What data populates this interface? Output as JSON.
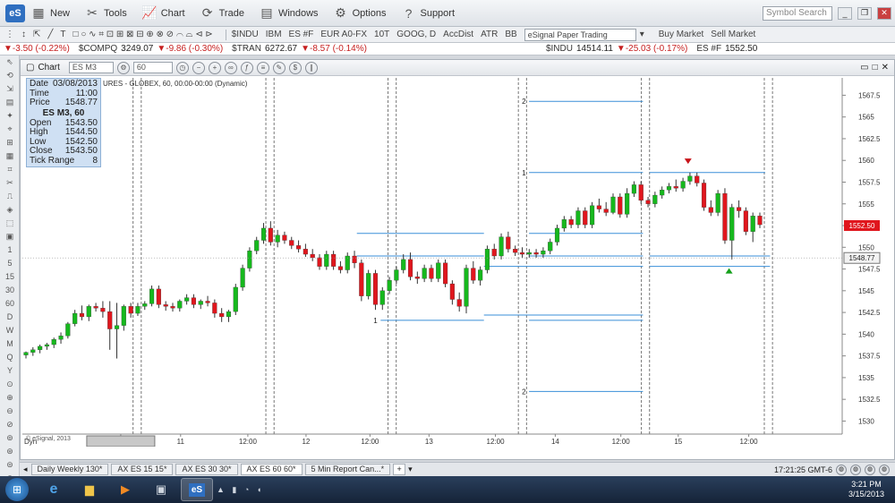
{
  "menu": {
    "logo": "eS",
    "items": [
      {
        "label": "New",
        "icon": "new-icon",
        "glyph": "▦"
      },
      {
        "label": "Tools",
        "icon": "tools-icon",
        "glyph": "✂"
      },
      {
        "label": "Chart",
        "icon": "chart-icon",
        "glyph": "📈"
      },
      {
        "label": "Trade",
        "icon": "trade-icon",
        "glyph": "⟳"
      },
      {
        "label": "Windows",
        "icon": "windows-icon",
        "glyph": "▤"
      },
      {
        "label": "Options",
        "icon": "options-gear-icon",
        "glyph": "⚙"
      },
      {
        "label": "Support",
        "icon": "support-help-icon",
        "glyph": "?"
      }
    ],
    "symbol_search_placeholder": "Symbol Search"
  },
  "toolbar": {
    "quick_symbols": [
      "$INDU",
      "IBM",
      "ES #F",
      "EUR A0-FX",
      "10T",
      "GOOG, D",
      "AccDist",
      "ATR",
      "BB"
    ],
    "account": "eSignal Paper Trading",
    "buy_market": "Buy Market",
    "sell_market": "Sell Market"
  },
  "ticker": [
    {
      "symbol": "",
      "change": "-3.50 (-0.22%)"
    },
    {
      "symbol": "$COMPQ",
      "price": "3249.07",
      "change": "-9.86 (-0.30%)"
    },
    {
      "symbol": "$TRAN",
      "price": "6272.67",
      "change": "-8.57 (-0.14%)"
    },
    {
      "symbol": "$INDU",
      "price": "14514.11",
      "change": "-25.03 (-0.17%)"
    },
    {
      "symbol": "ES #F",
      "price": "1552.50",
      "change": ""
    }
  ],
  "lefttools": [
    "1",
    "5",
    "15",
    "30",
    "60",
    "D",
    "W",
    "M",
    "Q",
    "Y"
  ],
  "chart_window": {
    "tab_label": "Chart",
    "symbol": "ES M3",
    "interval": "60",
    "title": "URES - GLOBEX, 60, 00:00-00:00 (Dynamic)",
    "copyright": "© eSignal, 2013",
    "dyn_label": "Dyn"
  },
  "info_panel": {
    "date_label": "Date",
    "date": "03/08/2013",
    "time_label": "Time",
    "time": "11:00",
    "price_label": "Price",
    "price": "1548.77",
    "symbol": "ES M3, 60",
    "open_label": "Open",
    "open": "1543.50",
    "high_label": "High",
    "high": "1544.50",
    "low_label": "Low",
    "low": "1542.50",
    "close_label": "Close",
    "close": "1543.50",
    "tick_label": "Tick Range",
    "tick": "8"
  },
  "chart_data": {
    "type": "candlestick",
    "ylim": [
      1528.5,
      1569.5
    ],
    "y_ticks": [
      1530,
      1532.5,
      1535,
      1537.5,
      1540,
      1542.5,
      1545,
      1547.5,
      1550,
      1552.5,
      1555,
      1557.5,
      1560,
      1562.5,
      1565,
      1567.5
    ],
    "x_labels": [
      "11:00 03/08/2013",
      "11",
      "12:00",
      "12",
      "12:00",
      "13",
      "12:00",
      "14",
      "12:00",
      "15",
      "12:00"
    ],
    "current_price": "1552.50",
    "cursor_price": "1548.77",
    "candles": [
      [
        1537.6,
        1538.0,
        1537.2,
        1537.9
      ],
      [
        1537.9,
        1538.5,
        1537.5,
        1538.2
      ],
      [
        1538.2,
        1538.8,
        1537.8,
        1538.6
      ],
      [
        1538.6,
        1539.0,
        1538.2,
        1538.8
      ],
      [
        1538.8,
        1539.6,
        1538.4,
        1539.4
      ],
      [
        1539.4,
        1540.2,
        1538.9,
        1539.8
      ],
      [
        1539.8,
        1541.4,
        1539.5,
        1541.2
      ],
      [
        1541.2,
        1542.8,
        1540.9,
        1542.4
      ],
      [
        1542.4,
        1543.3,
        1541.6,
        1542.0
      ],
      [
        1542.0,
        1543.4,
        1541.5,
        1543.2
      ],
      [
        1543.2,
        1543.6,
        1542.6,
        1543.0
      ],
      [
        1543.0,
        1543.8,
        1541.9,
        1542.6
      ],
      [
        1542.6,
        1543.8,
        1538.2,
        1540.6
      ],
      [
        1540.6,
        1543.6,
        1537.2,
        1541.0
      ],
      [
        1541.0,
        1543.4,
        1540.4,
        1543.2
      ],
      [
        1543.2,
        1543.6,
        1541.9,
        1542.4
      ],
      [
        1542.4,
        1543.6,
        1542.1,
        1543.2
      ],
      [
        1543.2,
        1543.8,
        1542.8,
        1543.5
      ],
      [
        1543.5,
        1545.6,
        1543.2,
        1545.2
      ],
      [
        1545.2,
        1545.6,
        1543.0,
        1543.4
      ],
      [
        1543.4,
        1543.8,
        1542.7,
        1543.2
      ],
      [
        1543.2,
        1543.6,
        1542.6,
        1543.0
      ],
      [
        1543.0,
        1544.0,
        1542.6,
        1543.8
      ],
      [
        1543.8,
        1544.6,
        1543.4,
        1544.2
      ],
      [
        1544.2,
        1544.6,
        1543.0,
        1543.4
      ],
      [
        1543.4,
        1544.0,
        1542.9,
        1543.8
      ],
      [
        1543.8,
        1544.4,
        1543.2,
        1543.6
      ],
      [
        1543.6,
        1544.0,
        1541.9,
        1542.4
      ],
      [
        1542.4,
        1543.0,
        1541.4,
        1542.0
      ],
      [
        1542.0,
        1542.8,
        1541.4,
        1542.6
      ],
      [
        1542.6,
        1545.8,
        1542.2,
        1545.4
      ],
      [
        1545.4,
        1548.0,
        1545.0,
        1547.6
      ],
      [
        1547.6,
        1550.0,
        1547.2,
        1549.6
      ],
      [
        1549.6,
        1551.2,
        1549.2,
        1550.8
      ],
      [
        1550.8,
        1552.8,
        1550.4,
        1552.2
      ],
      [
        1552.2,
        1553.0,
        1550.2,
        1550.6
      ],
      [
        1550.6,
        1552.0,
        1550.0,
        1551.4
      ],
      [
        1551.4,
        1551.8,
        1550.4,
        1550.8
      ],
      [
        1550.8,
        1551.2,
        1549.8,
        1550.2
      ],
      [
        1550.2,
        1550.8,
        1549.4,
        1549.8
      ],
      [
        1549.8,
        1550.4,
        1548.9,
        1549.2
      ],
      [
        1549.2,
        1549.8,
        1548.4,
        1548.8
      ],
      [
        1548.8,
        1549.2,
        1547.4,
        1547.8
      ],
      [
        1547.8,
        1549.6,
        1547.4,
        1549.2
      ],
      [
        1549.2,
        1549.6,
        1547.4,
        1547.8
      ],
      [
        1547.8,
        1548.4,
        1547.0,
        1547.4
      ],
      [
        1547.4,
        1549.4,
        1547.0,
        1549.0
      ],
      [
        1549.0,
        1549.6,
        1547.6,
        1548.2
      ],
      [
        1548.2,
        1548.6,
        1543.8,
        1544.4
      ],
      [
        1544.4,
        1547.4,
        1544.0,
        1547.0
      ],
      [
        1547.0,
        1547.4,
        1542.8,
        1543.4
      ],
      [
        1543.4,
        1545.4,
        1542.8,
        1545.0
      ],
      [
        1545.0,
        1546.6,
        1544.6,
        1546.2
      ],
      [
        1546.2,
        1547.8,
        1545.8,
        1547.4
      ],
      [
        1547.4,
        1549.2,
        1547.0,
        1548.6
      ],
      [
        1548.6,
        1549.4,
        1546.2,
        1546.6
      ],
      [
        1546.6,
        1547.2,
        1545.8,
        1546.4
      ],
      [
        1546.4,
        1548.0,
        1546.0,
        1547.6
      ],
      [
        1547.6,
        1548.0,
        1546.0,
        1546.4
      ],
      [
        1546.4,
        1548.6,
        1546.0,
        1548.2
      ],
      [
        1548.2,
        1548.6,
        1545.4,
        1545.8
      ],
      [
        1545.8,
        1546.2,
        1543.4,
        1544.0
      ],
      [
        1544.0,
        1544.8,
        1542.6,
        1543.2
      ],
      [
        1543.2,
        1548.0,
        1542.4,
        1547.6
      ],
      [
        1547.6,
        1548.4,
        1545.8,
        1546.2
      ],
      [
        1546.2,
        1547.8,
        1545.6,
        1547.4
      ],
      [
        1547.4,
        1550.2,
        1547.0,
        1549.8
      ],
      [
        1549.8,
        1550.4,
        1548.6,
        1549.0
      ],
      [
        1549.0,
        1551.6,
        1548.6,
        1551.2
      ],
      [
        1551.2,
        1551.8,
        1549.4,
        1549.8
      ],
      [
        1549.8,
        1550.2,
        1549.0,
        1549.4
      ],
      [
        1549.4,
        1550.0,
        1548.8,
        1549.2
      ],
      [
        1549.2,
        1549.8,
        1548.8,
        1549.4
      ],
      [
        1549.4,
        1549.8,
        1548.8,
        1549.2
      ],
      [
        1549.2,
        1550.0,
        1548.8,
        1549.6
      ],
      [
        1549.6,
        1551.0,
        1549.2,
        1550.6
      ],
      [
        1550.6,
        1552.6,
        1550.2,
        1552.2
      ],
      [
        1552.2,
        1553.6,
        1551.8,
        1553.2
      ],
      [
        1553.2,
        1553.6,
        1552.2,
        1552.6
      ],
      [
        1552.6,
        1554.6,
        1552.2,
        1554.2
      ],
      [
        1554.2,
        1554.6,
        1552.2,
        1552.6
      ],
      [
        1552.6,
        1555.2,
        1552.2,
        1554.8
      ],
      [
        1554.8,
        1555.6,
        1554.0,
        1554.4
      ],
      [
        1554.4,
        1555.2,
        1553.6,
        1554.0
      ],
      [
        1554.0,
        1556.2,
        1553.8,
        1555.8
      ],
      [
        1555.8,
        1556.2,
        1553.4,
        1553.8
      ],
      [
        1553.8,
        1556.8,
        1553.4,
        1556.2
      ],
      [
        1556.2,
        1557.6,
        1555.8,
        1557.2
      ],
      [
        1557.2,
        1557.6,
        1555.0,
        1555.4
      ],
      [
        1555.4,
        1555.8,
        1554.6,
        1555.0
      ],
      [
        1555.0,
        1556.4,
        1554.6,
        1556.0
      ],
      [
        1556.0,
        1557.0,
        1555.6,
        1556.6
      ],
      [
        1556.6,
        1557.4,
        1556.2,
        1557.0
      ],
      [
        1557.0,
        1557.8,
        1556.4,
        1556.8
      ],
      [
        1556.8,
        1558.0,
        1556.4,
        1557.6
      ],
      [
        1557.6,
        1558.6,
        1557.2,
        1558.2
      ],
      [
        1558.2,
        1558.6,
        1557.0,
        1557.4
      ],
      [
        1557.4,
        1557.8,
        1554.2,
        1554.6
      ],
      [
        1554.6,
        1555.4,
        1553.6,
        1554.0
      ],
      [
        1554.0,
        1556.6,
        1553.6,
        1556.2
      ],
      [
        1556.2,
        1556.8,
        1550.4,
        1550.8
      ],
      [
        1550.8,
        1555.0,
        1548.6,
        1554.6
      ],
      [
        1554.6,
        1555.4,
        1553.4,
        1554.2
      ],
      [
        1554.2,
        1554.6,
        1551.4,
        1551.8
      ],
      [
        1551.8,
        1554.0,
        1550.6,
        1553.6
      ],
      [
        1553.6,
        1554.0,
        1552.2,
        1552.6
      ]
    ],
    "levels": [
      {
        "label": "2",
        "y": 1566.8,
        "x0": 0.618,
        "x1": 0.757
      },
      {
        "label": "1",
        "y": 1558.6,
        "x0": 0.618,
        "x1": 0.757
      },
      {
        "label": "",
        "y": 1558.6,
        "x0": 0.765,
        "x1": 0.906
      },
      {
        "label": "",
        "y": 1551.6,
        "x0": 0.408,
        "x1": 0.563
      },
      {
        "label": "",
        "y": 1551.6,
        "x0": 0.618,
        "x1": 0.757
      },
      {
        "label": "",
        "y": 1549.0,
        "x0": 0.408,
        "x1": 0.563
      },
      {
        "label": "",
        "y": 1549.0,
        "x0": 0.618,
        "x1": 0.757
      },
      {
        "label": "",
        "y": 1549.0,
        "x0": 0.765,
        "x1": 0.912
      },
      {
        "label": "",
        "y": 1547.8,
        "x0": 0.563,
        "x1": 0.757
      },
      {
        "label": "",
        "y": 1547.8,
        "x0": 0.765,
        "x1": 0.912
      },
      {
        "label": "",
        "y": 1542.2,
        "x0": 0.563,
        "x1": 0.757
      },
      {
        "label": "1",
        "y": 1541.6,
        "x0": 0.437,
        "x1": 0.563
      },
      {
        "label": "",
        "y": 1541.6,
        "x0": 0.618,
        "x1": 0.757
      },
      {
        "label": "2",
        "y": 1533.4,
        "x0": 0.618,
        "x1": 0.757
      }
    ],
    "session_breaks": [
      0.135,
      0.145,
      0.297,
      0.307,
      0.446,
      0.456,
      0.605,
      0.615,
      0.755,
      0.765,
      0.905,
      0.915
    ],
    "arrows": [
      {
        "type": "down",
        "x": 0.812,
        "y": 1559.6
      },
      {
        "type": "up",
        "x": 0.862,
        "y": 1547.6
      }
    ]
  },
  "tabs": [
    {
      "label": "Daily Weekly 130*",
      "active": false
    },
    {
      "label": "AX ES 15 15*",
      "active": false
    },
    {
      "label": "AX ES 30 30*",
      "active": false
    },
    {
      "label": "AX ES 60 60*",
      "active": true
    },
    {
      "label": "5 Min Report Can...*",
      "active": false
    }
  ],
  "status": {
    "time": "17:21:25 GMT-6"
  },
  "taskbar": {
    "time": "3:21 PM",
    "date": "3/15/2013"
  },
  "colors": {
    "up": "#16b81d",
    "down": "#e0161d",
    "level": "#3a8fd8",
    "panel": "#cfe0f3"
  }
}
